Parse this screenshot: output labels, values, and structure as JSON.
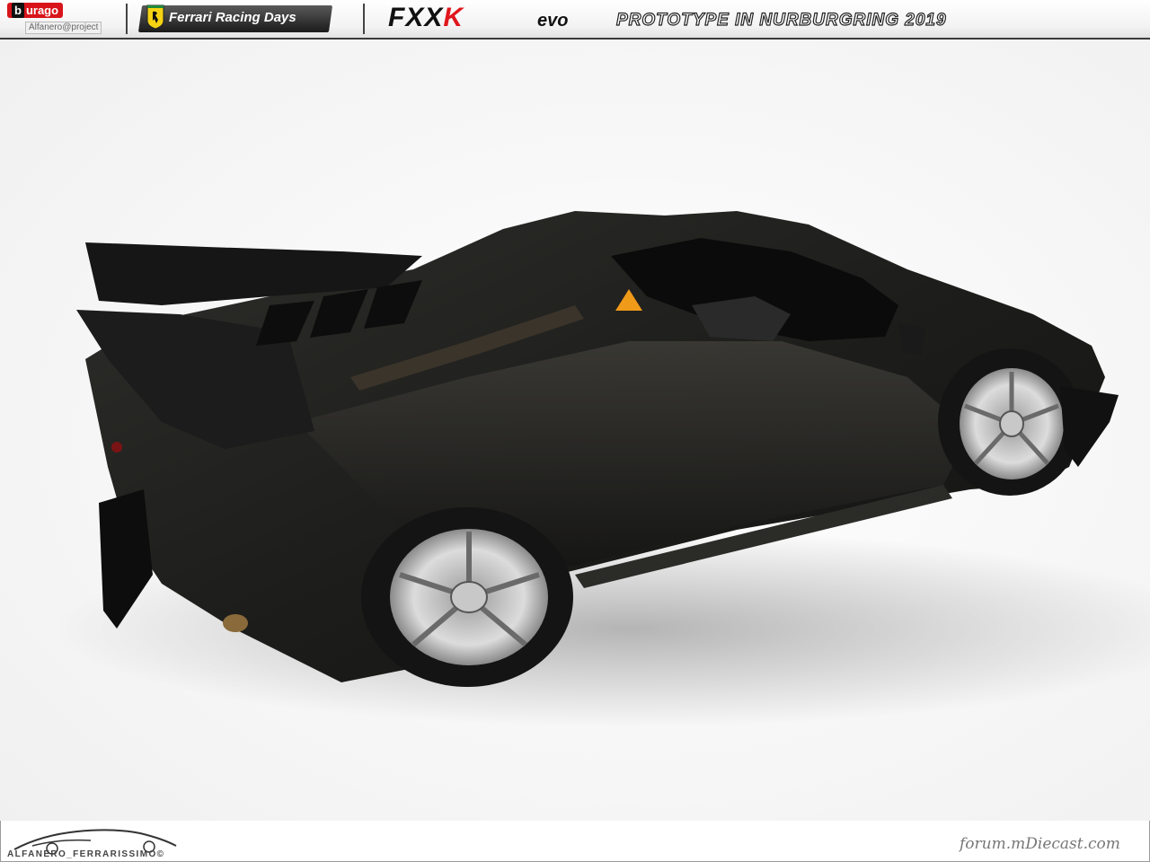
{
  "header": {
    "brand_logo": "urago",
    "brand_logo_prefix": "b",
    "project_text": "Alfanero@project",
    "series_title": "Ferrari Racing Days",
    "model_name_prefix": "FXX",
    "model_name_k": "K",
    "model_variant": "evo",
    "subtitle": "PROTOTYPE IN NURBURGRING 2019"
  },
  "photo": {
    "subject": "car-model"
  },
  "footer": {
    "signature_text": "ALFANERO_FERRARISSIMO©",
    "watermark": "forum.mDiecast.com"
  },
  "colors": {
    "accent_red": "#e0171d",
    "car_body": "#1f1f1d"
  }
}
